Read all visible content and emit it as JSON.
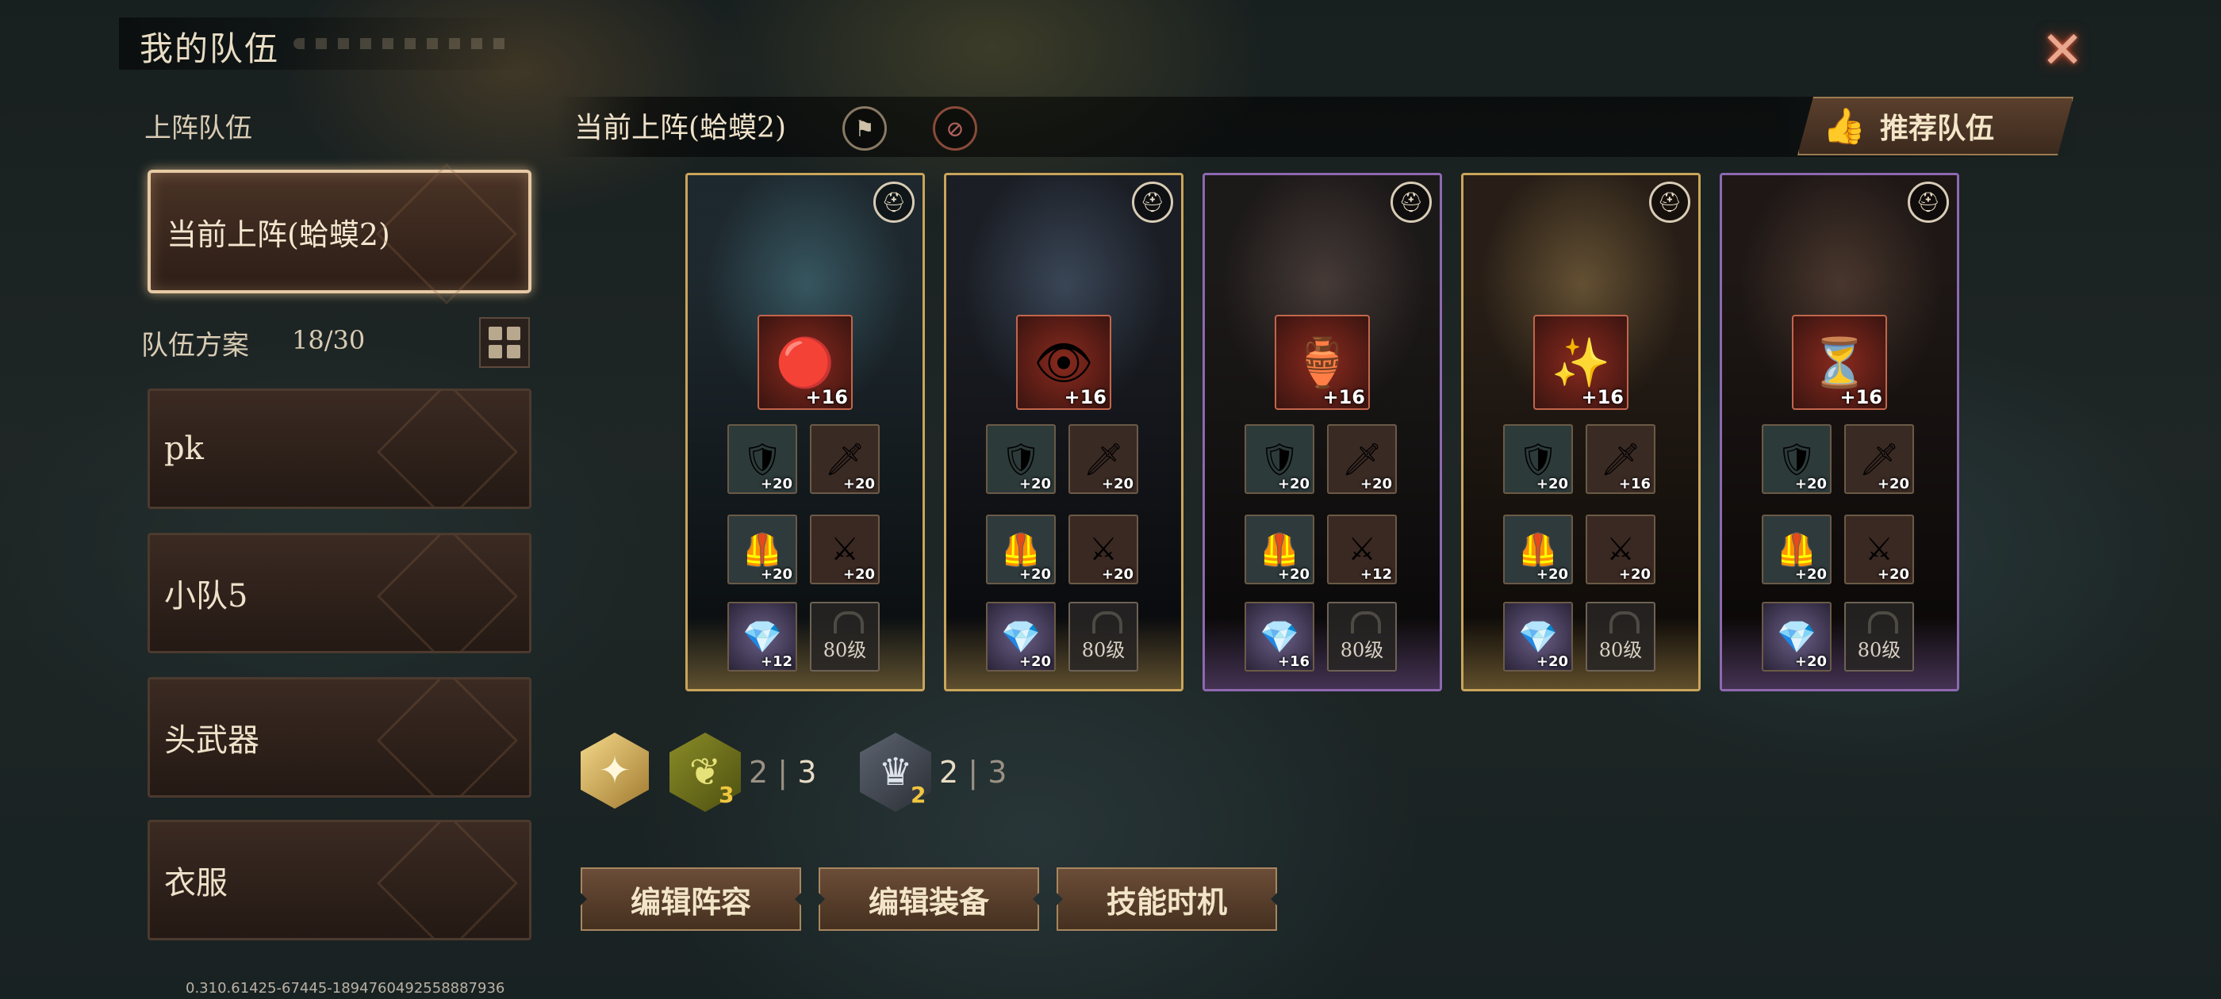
{
  "header": {
    "title": "我的队伍"
  },
  "close_icon": "close-x-icon",
  "sidebar": {
    "section_label": "上阵队伍",
    "current_team": "当前上阵(蛤蟆2)",
    "plans_label": "队伍方案",
    "plans_count": "18/30",
    "teams": [
      "pk",
      "小队5",
      "头武器",
      "衣服"
    ]
  },
  "lineup": {
    "title": "当前上阵(蛤蟆2)",
    "recommend_label": "推荐队伍"
  },
  "heroes": [
    {
      "frame": "gold",
      "portrait_colors": [
        "#3a5b66",
        "#1f2a30"
      ],
      "main_item": "+16",
      "main_icon": "🔴",
      "slots": [
        "+20",
        "+20",
        "+20",
        "+20"
      ],
      "gem": "+12",
      "lock_label": "80级"
    },
    {
      "frame": "gold",
      "portrait_colors": [
        "#3d4a5c",
        "#1c1f26"
      ],
      "main_item": "+16",
      "main_icon": "👁",
      "slots": [
        "+20",
        "+20",
        "+20",
        "+20"
      ],
      "gem": "+20",
      "lock_label": "80级"
    },
    {
      "frame": "purple",
      "portrait_colors": [
        "#4a3e3a",
        "#1e1a1a"
      ],
      "main_item": "+16",
      "main_icon": "🏺",
      "slots": [
        "+20",
        "+20",
        "+20",
        "+12"
      ],
      "gem": "+16",
      "lock_label": "80级"
    },
    {
      "frame": "gold",
      "portrait_colors": [
        "#6a5536",
        "#2a2018"
      ],
      "main_item": "+16",
      "main_icon": "✨",
      "slots": [
        "+20",
        "+16",
        "+20",
        "+20"
      ],
      "gem": "+20",
      "lock_label": "80级"
    },
    {
      "frame": "purple",
      "portrait_colors": [
        "#4e3a30",
        "#1f1816"
      ],
      "main_item": "+16",
      "main_icon": "⏳",
      "slots": [
        "+20",
        "+20",
        "+20",
        "+20"
      ],
      "gem": "+20",
      "lock_label": "80级"
    }
  ],
  "synergies": {
    "first": {
      "sub": "3",
      "have": "2",
      "sep": "|",
      "need": "3"
    },
    "second": {
      "sub": "2",
      "have": "2",
      "sep": "|",
      "need": "3"
    }
  },
  "actions": {
    "edit_lineup": "编辑阵容",
    "edit_gear": "编辑装备",
    "skill_timing": "技能时机"
  },
  "footer": {
    "version": "0.310.61425-67445-1894760492558887936"
  }
}
